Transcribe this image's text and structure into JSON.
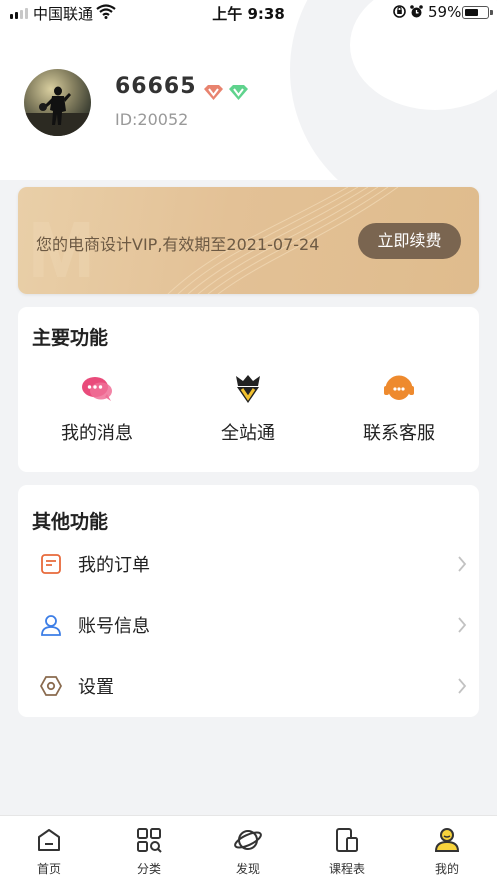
{
  "status_bar": {
    "carrier": "中国联通",
    "time": "上午 9:38",
    "battery": "59%"
  },
  "profile": {
    "username": "66665",
    "user_id": "ID:20052"
  },
  "vip": {
    "text": "您的电商设计VIP,有效期至2021-07-24",
    "button": "立即续费"
  },
  "main_functions": {
    "title": "主要功能",
    "items": [
      {
        "label": "我的消息",
        "icon": "message-icon"
      },
      {
        "label": "全站通",
        "icon": "vip-crown-icon"
      },
      {
        "label": "联系客服",
        "icon": "customer-service-icon"
      }
    ]
  },
  "other_functions": {
    "title": "其他功能",
    "items": [
      {
        "label": "我的订单",
        "icon": "order-icon"
      },
      {
        "label": "账号信息",
        "icon": "account-icon"
      },
      {
        "label": "设置",
        "icon": "settings-icon"
      }
    ]
  },
  "tab_bar": {
    "items": [
      {
        "label": "首页",
        "icon": "home-icon"
      },
      {
        "label": "分类",
        "icon": "category-icon"
      },
      {
        "label": "发现",
        "icon": "discover-icon"
      },
      {
        "label": "课程表",
        "icon": "schedule-icon"
      },
      {
        "label": "我的",
        "icon": "mine-icon"
      }
    ],
    "active_index": 4
  },
  "colors": {
    "accent_text": "#222222",
    "vip_card": "#e3c196",
    "vip_button": "#7a6550",
    "message_icon": "#e94b7b",
    "service_icon": "#ee8a2e",
    "order_icon": "#e86a3b",
    "account_icon": "#3d7ee6",
    "settings_icon": "#8a6b4f"
  }
}
